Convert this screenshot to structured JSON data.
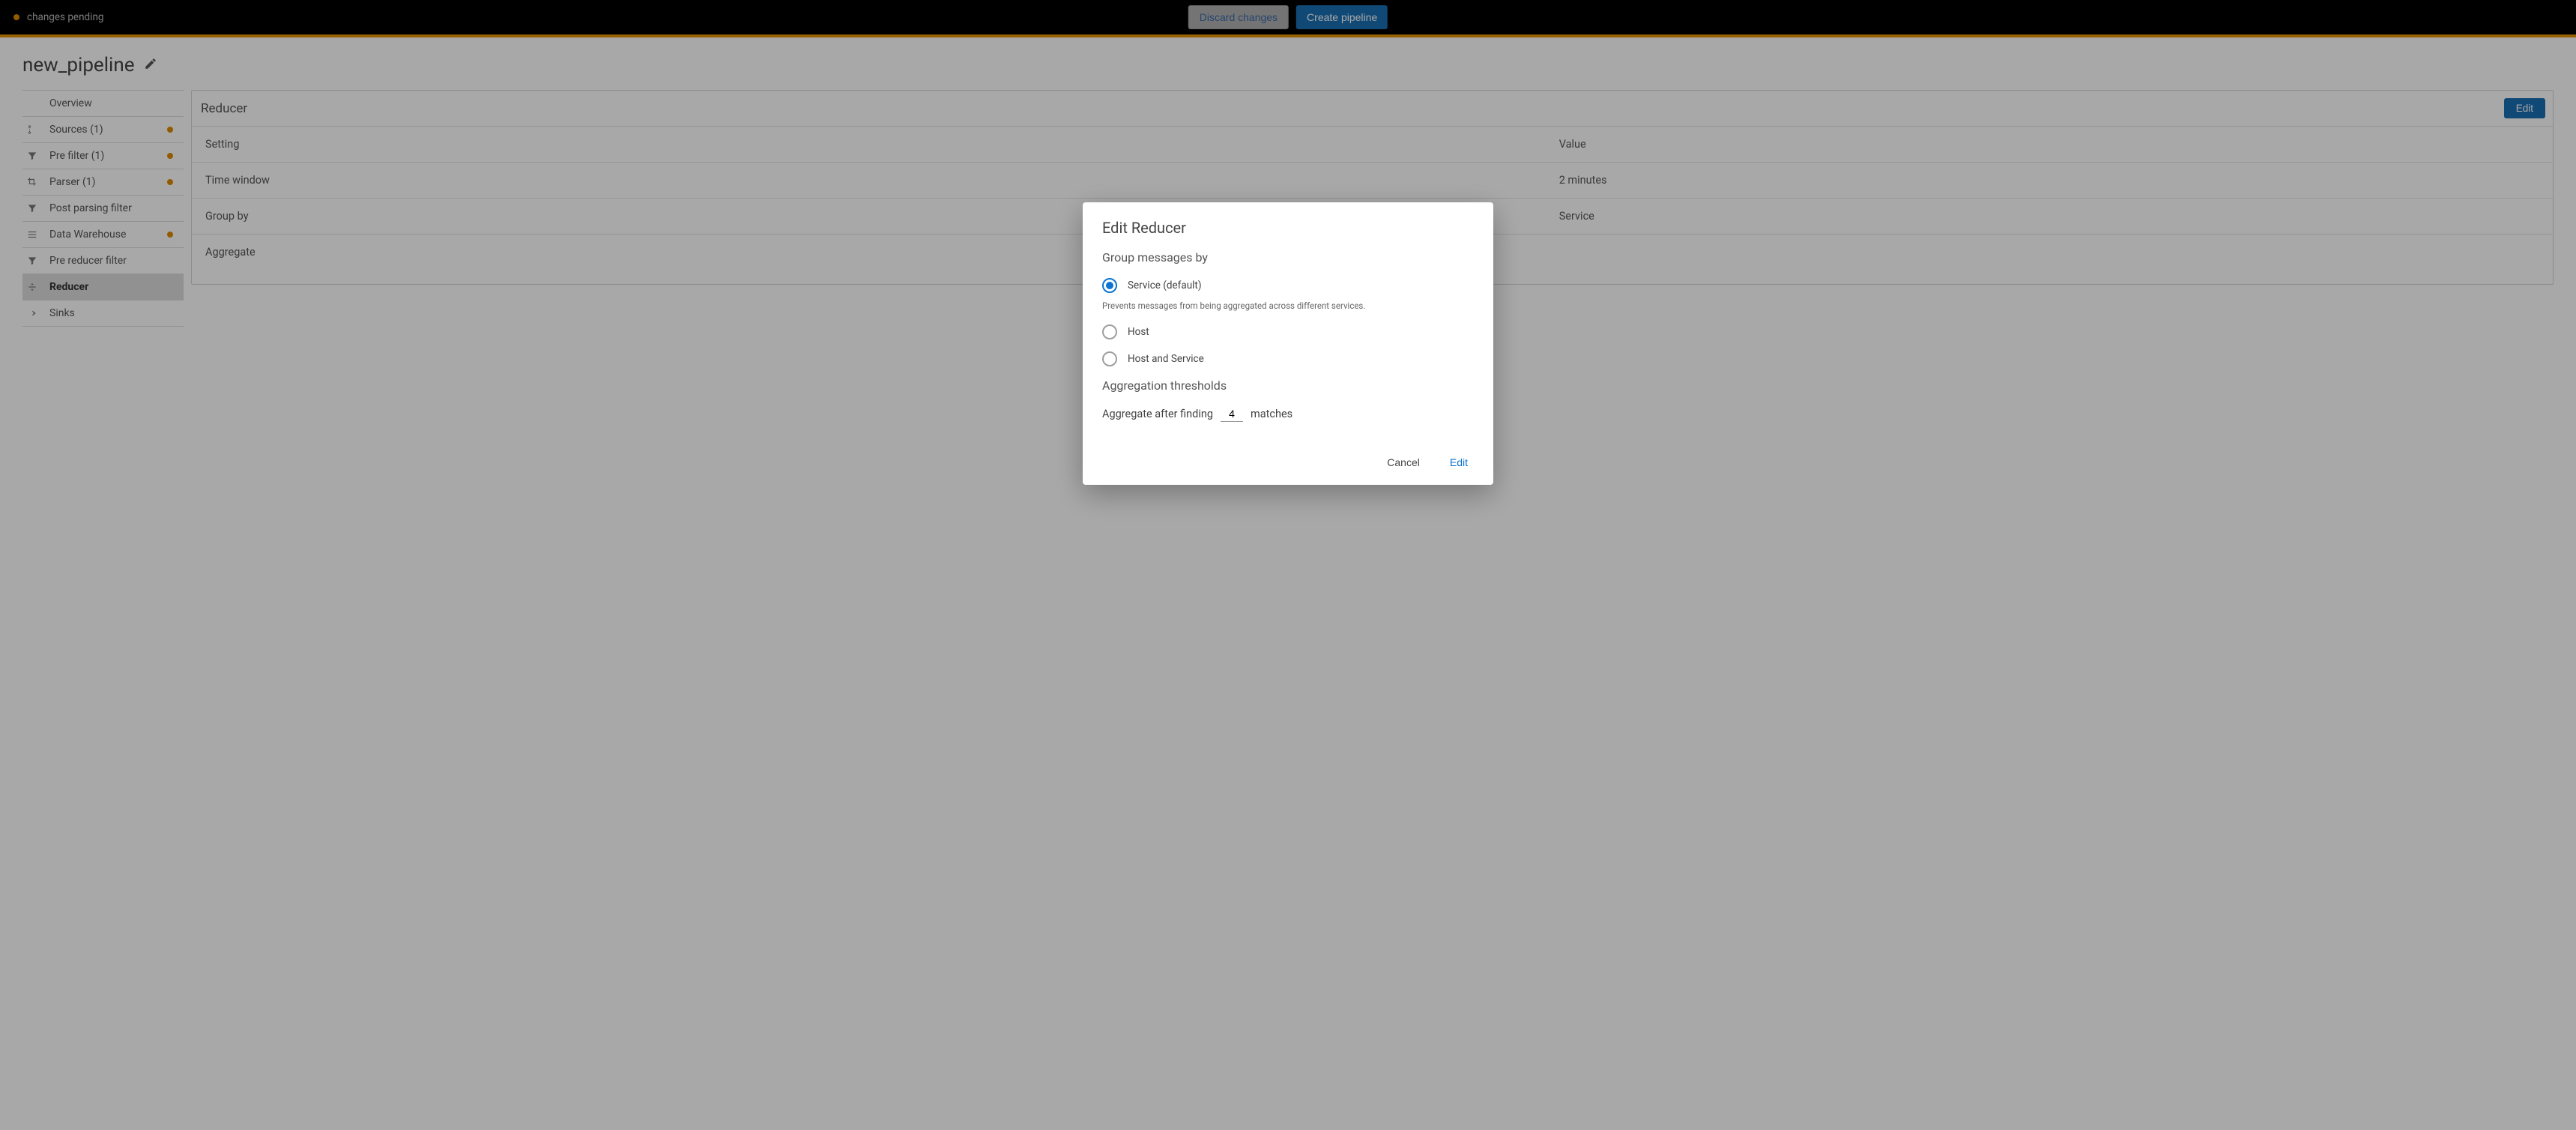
{
  "topbar": {
    "status_text": "changes pending",
    "discard_label": "Discard changes",
    "create_label": "Create pipeline"
  },
  "page": {
    "title": "new_pipeline"
  },
  "sidebar": {
    "items": [
      {
        "label": "Overview",
        "icon": "",
        "dot": false,
        "active": false
      },
      {
        "label": "Sources (1)",
        "icon": "flow",
        "dot": true,
        "active": false
      },
      {
        "label": "Pre filter (1)",
        "icon": "filter",
        "dot": true,
        "active": false
      },
      {
        "label": "Parser (1)",
        "icon": "crop",
        "dot": true,
        "active": false
      },
      {
        "label": "Post parsing filter",
        "icon": "filter",
        "dot": false,
        "active": false
      },
      {
        "label": "Data Warehouse",
        "icon": "list",
        "dot": true,
        "active": false
      },
      {
        "label": "Pre reducer filter",
        "icon": "filter",
        "dot": false,
        "active": false
      },
      {
        "label": "Reducer",
        "icon": "compress",
        "dot": false,
        "active": true
      },
      {
        "label": "Sinks",
        "icon": "arrow",
        "dot": false,
        "active": false
      }
    ]
  },
  "panel": {
    "title": "Reducer",
    "edit_label": "Edit",
    "header_key": "Setting",
    "header_val": "Value",
    "rows": [
      {
        "key": "Time window",
        "val": "2 minutes"
      },
      {
        "key": "Group by",
        "val": "Service"
      },
      {
        "key": "Aggregate",
        "val": ""
      }
    ]
  },
  "modal": {
    "title": "Edit Reducer",
    "group_label": "Group messages by",
    "options": [
      {
        "label": "Service (default)",
        "selected": true
      },
      {
        "label": "Host",
        "selected": false
      },
      {
        "label": "Host and Service",
        "selected": false
      }
    ],
    "helper": "Prevents messages from being aggregated across different services.",
    "thresh_label": "Aggregation thresholds",
    "thresh_before": "Aggregate after finding",
    "thresh_value": "4",
    "thresh_after": "matches",
    "cancel_label": "Cancel",
    "edit_label": "Edit"
  }
}
